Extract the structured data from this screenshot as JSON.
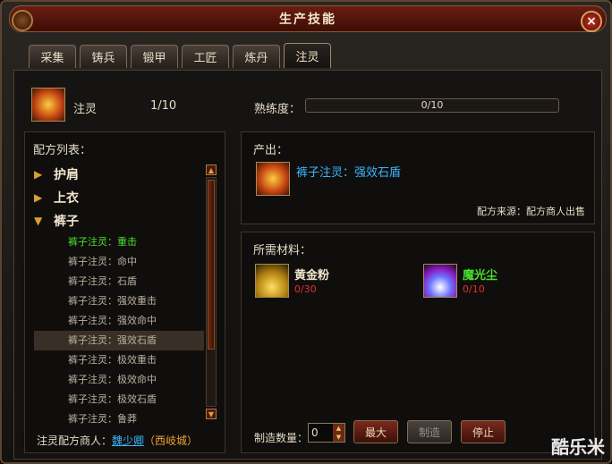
{
  "window": {
    "title": "生产技能",
    "close": "×"
  },
  "tabs": [
    {
      "label": "采集"
    },
    {
      "label": "铸兵"
    },
    {
      "label": "锻甲"
    },
    {
      "label": "工匠"
    },
    {
      "label": "炼丹"
    },
    {
      "label": "注灵",
      "active": true
    }
  ],
  "skill": {
    "name": "注灵",
    "level": "1/10",
    "proficiency_label": "熟练度：",
    "proficiency_text": "0/10",
    "proficiency_fraction": 0
  },
  "recipe_list": {
    "label": "配方列表：",
    "categories": [
      {
        "name": "护肩",
        "expanded": false
      },
      {
        "name": "上衣",
        "expanded": false
      },
      {
        "name": "裤子",
        "expanded": true
      }
    ],
    "items": [
      "裤子注灵：重击",
      "裤子注灵：命中",
      "裤子注灵：石盾",
      "裤子注灵：强效重击",
      "裤子注灵：强效命中",
      "裤子注灵：强效石盾",
      "裤子注灵：极效重击",
      "裤子注灵：极效命中",
      "裤子注灵：极效石盾",
      "裤子注灵：鲁莽"
    ],
    "highlight_index": 0,
    "selected_index": 5
  },
  "merchant": {
    "label": "注灵配方商人：",
    "npc": "魏少卿",
    "city": "（西岐城）"
  },
  "output": {
    "label": "产出：",
    "item": "裤子注灵：强效石盾",
    "source": "配方来源：配方商人出售"
  },
  "materials": {
    "label": "所需材料：",
    "items": [
      {
        "name": "黄金粉",
        "count": "0/30",
        "color": "#f0e6d0",
        "icon": "gold-powder-icon"
      },
      {
        "name": "魔光尘",
        "count": "0/10",
        "color": "#46e02e",
        "icon": "magic-dust-icon"
      }
    ]
  },
  "craft": {
    "qty_label": "制造数量：",
    "qty_value": "0",
    "max": "最大",
    "make": "制造",
    "stop": "停止"
  },
  "watermark": "酷乐米"
}
